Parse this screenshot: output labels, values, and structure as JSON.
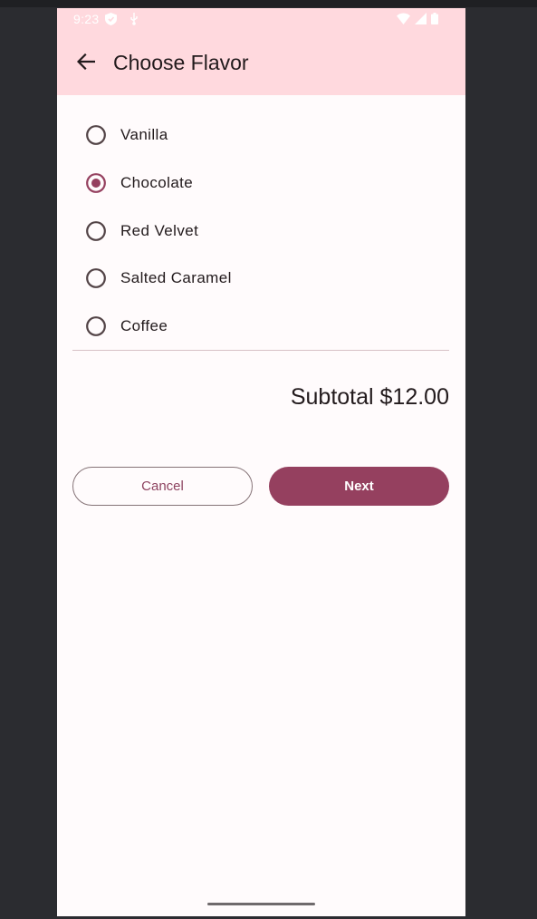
{
  "status_bar": {
    "time": "9:23",
    "left_icons": [
      "shield-icon",
      "usb-icon"
    ],
    "right_icons": [
      "wifi-icon",
      "signal-icon",
      "battery-icon"
    ]
  },
  "app_bar": {
    "back_icon": "arrow-back-icon",
    "title": "Choose Flavor"
  },
  "flavors": {
    "selected": "Chocolate",
    "options": [
      {
        "label": "Vanilla",
        "selected": false
      },
      {
        "label": "Chocolate",
        "selected": true
      },
      {
        "label": "Red Velvet",
        "selected": false
      },
      {
        "label": "Salted Caramel",
        "selected": false
      },
      {
        "label": "Coffee",
        "selected": false
      }
    ]
  },
  "summary": {
    "subtotal": "Subtotal $12.00"
  },
  "actions": {
    "cancel_label": "Cancel",
    "next_label": "Next"
  },
  "colors": {
    "app_bar_bg": "#ffd9de",
    "accent": "#95405f",
    "surface": "#fffbfc"
  }
}
